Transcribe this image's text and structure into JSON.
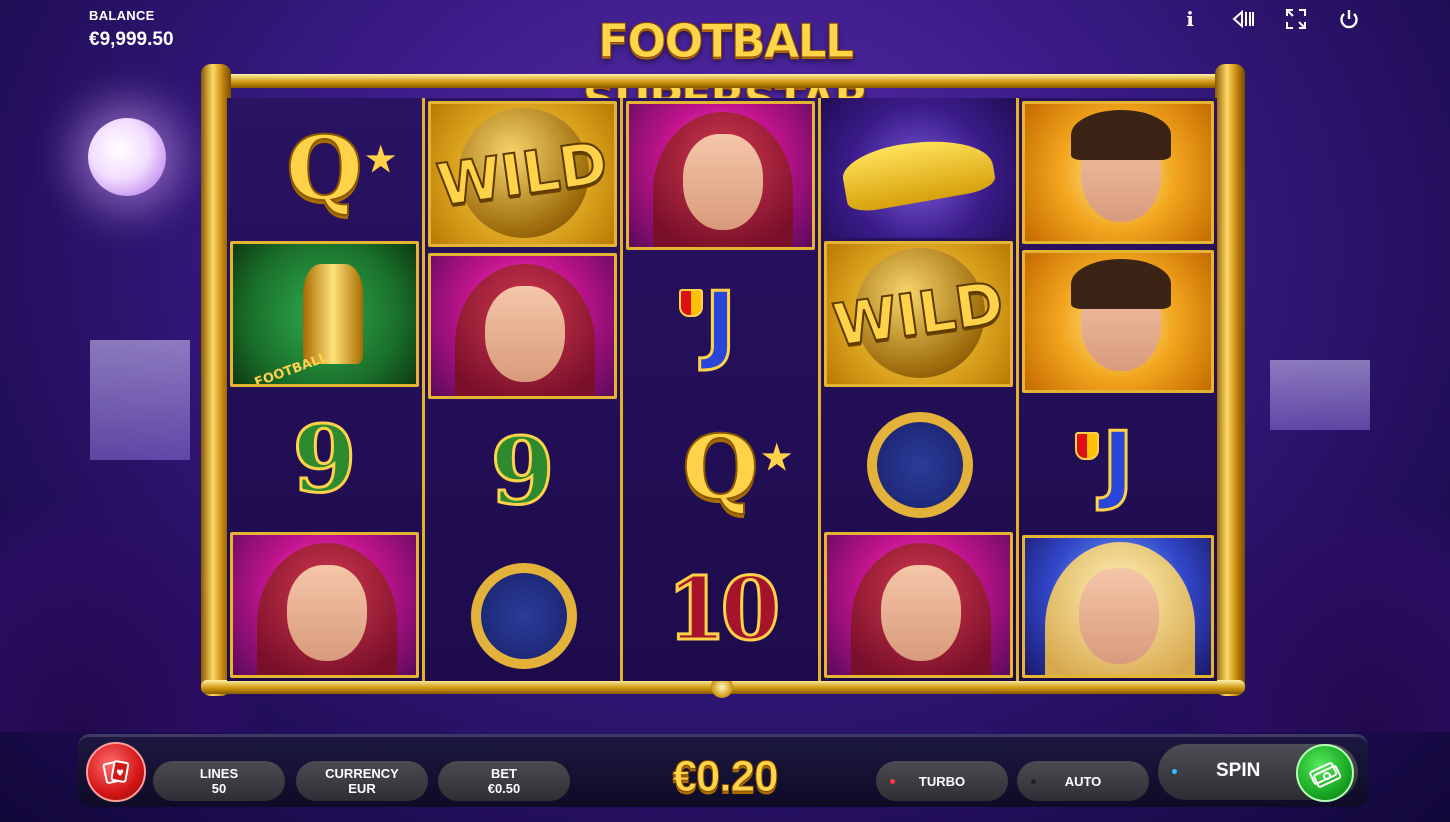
{
  "header": {
    "balance_label": "BALANCE",
    "balance_value": "€9,999.50",
    "logo_text": "FOOTBALL SUPERSTAR"
  },
  "top_icons": [
    "info-icon",
    "sound-icon",
    "fullscreen-icon",
    "power-icon"
  ],
  "top_icon_glyphs": [
    "i",
    "◁|||",
    "⛶",
    "⏻"
  ],
  "reels": [
    [
      "Q",
      "TROPHY",
      "9",
      "GIRL_RED"
    ],
    [
      "WILD",
      "GIRL_RED",
      "9",
      "WATCH"
    ],
    [
      "GIRL_RED",
      "J",
      "Q",
      "10"
    ],
    [
      "CAR",
      "WILD",
      "WATCH",
      "GIRL_RED"
    ],
    [
      "PLAYER",
      "PLAYER",
      "J",
      "GIRL_BLONDE"
    ]
  ],
  "symbols": {
    "q": "Q",
    "j": "J",
    "nine": "9",
    "ten": "10",
    "wild": "WILD",
    "trophy_text": "FOOTBALL"
  },
  "controls": {
    "lines_label": "LINES",
    "lines_value": "50",
    "currency_label": "CURRENCY",
    "currency_value": "EUR",
    "bet_label": "BET",
    "bet_value": "€0.50",
    "stake": "€0.20",
    "turbo_label": "TURBO",
    "auto_label": "AUTO",
    "spin_label": "SPIN"
  },
  "colors": {
    "gold": "#e2b228",
    "turbo_dot": "#ff3b3b",
    "auto_dot": "#222222",
    "spin_dot": "#2ec0ff",
    "spin_button": "#1aa924",
    "card_button": "#d31616"
  }
}
